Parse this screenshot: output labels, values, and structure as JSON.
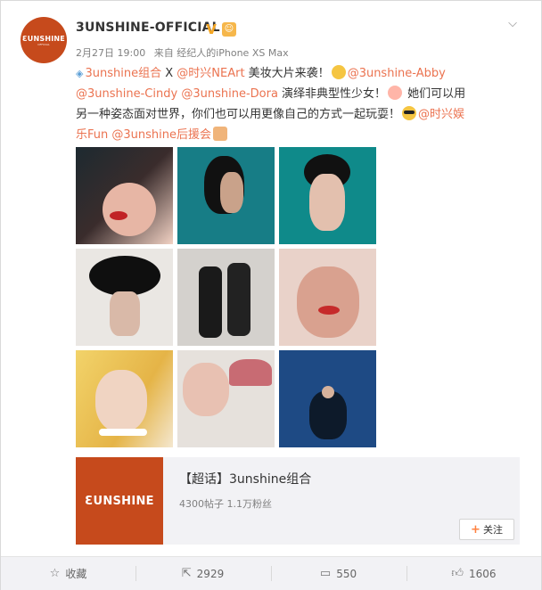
{
  "account": {
    "avatar_text": "ƐUNSHINE",
    "avatar_sub": "OFFICIAL",
    "username": "3UNSHINE-OFFICIAL",
    "verified_icon": "verified-v-icon",
    "medal_icon": "fan-medal-icon"
  },
  "meta": {
    "date": "2月27日 19:00",
    "source": "来自 经纪人的iPhone XS Max"
  },
  "post": {
    "topic_link": "3unshine组合",
    "seg1": " X ",
    "link_neart": "@时兴NEArt",
    "seg2": " 美妆大片来袭！",
    "mention_abby": "@3unshine-Abby",
    "mention_cindy": "@3unshine-Cindy",
    "mention_dora": "@3unshine-Dora",
    "seg3": " 演绎非典型性少女！",
    "seg4": " 她们可以用另一种姿态面对世界，你们也可以用更像自己的方式一起玩耍！",
    "mention_fun": "@时兴娱乐Fun",
    "mention_fans": "@3unshine后援会"
  },
  "images": [
    {
      "name": "photo-1"
    },
    {
      "name": "photo-2"
    },
    {
      "name": "photo-3"
    },
    {
      "name": "photo-4"
    },
    {
      "name": "photo-5"
    },
    {
      "name": "photo-6"
    },
    {
      "name": "photo-7"
    },
    {
      "name": "photo-8"
    },
    {
      "name": "photo-9"
    }
  ],
  "topic_card": {
    "logo_text": "ƐUNSHINE",
    "title": "【超话】3unshine组合",
    "stats": "4300帖子 1.1万粉丝",
    "follow_label": "关注"
  },
  "actions": {
    "collect_label": "收藏",
    "repost_count": "2929",
    "comment_count": "550",
    "like_count": "1606"
  },
  "colors": {
    "brand": "#c64a1c",
    "link": "#eb7350",
    "action_bar": "#f2f2f5"
  }
}
